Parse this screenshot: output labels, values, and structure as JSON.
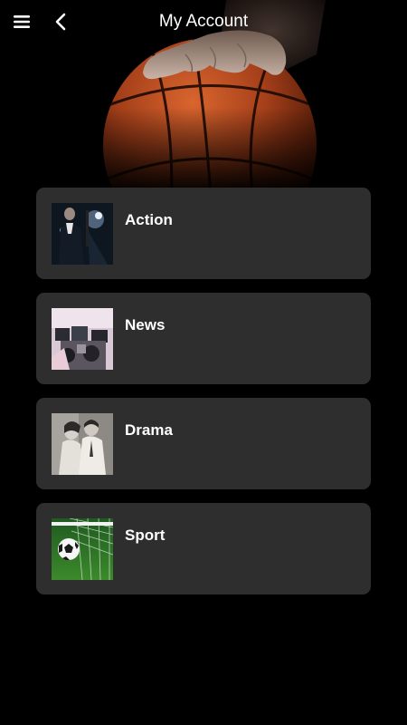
{
  "header": {
    "title": "My Account",
    "menu_icon": "hamburger-menu-icon",
    "back_icon": "chevron-left-icon"
  },
  "hero": {
    "image": "basketball-hand-image"
  },
  "categories": [
    {
      "label": "Action",
      "thumbnail": "action-thumbnail"
    },
    {
      "label": "News",
      "thumbnail": "news-thumbnail"
    },
    {
      "label": "Drama",
      "thumbnail": "drama-thumbnail"
    },
    {
      "label": "Sport",
      "thumbnail": "sport-thumbnail"
    }
  ],
  "colors": {
    "background": "#000000",
    "card": "#2e2e2e",
    "text": "#ffffff"
  }
}
